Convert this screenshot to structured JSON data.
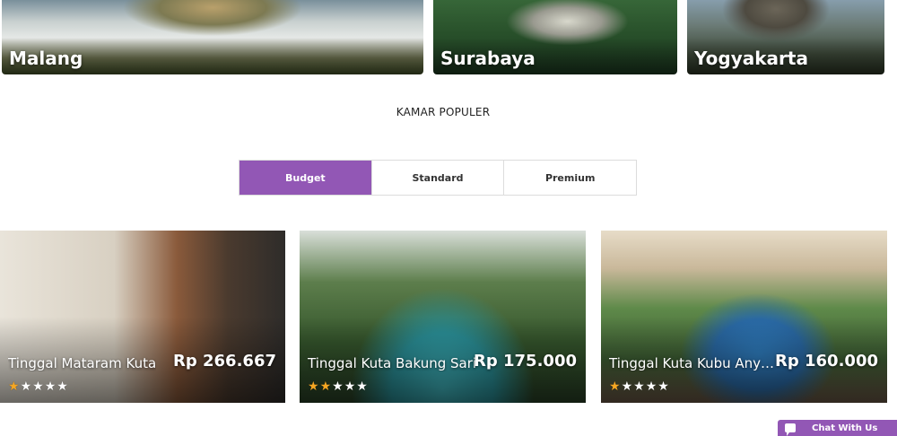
{
  "cities": [
    {
      "name": "Malang"
    },
    {
      "name": "Surabaya"
    },
    {
      "name": "Yogyakarta"
    }
  ],
  "section": {
    "title": "KAMAR POPULER"
  },
  "tabs": [
    {
      "label": "Budget",
      "active": true
    },
    {
      "label": "Standard",
      "active": false
    },
    {
      "label": "Premium",
      "active": false
    }
  ],
  "rooms": [
    {
      "name": "Tinggal Mataram Kuta",
      "price": "Rp 266.667",
      "rating": 1
    },
    {
      "name": "Tinggal Kuta Bakung Sari",
      "price": "Rp 175.000",
      "rating": 2
    },
    {
      "name": "Tinggal Kuta Kubu Anyar ...",
      "price": "Rp 160.000",
      "rating": 1
    }
  ],
  "chat": {
    "label": "Chat With Us"
  },
  "colors": {
    "accent": "#9257b5",
    "star": "#f5a623"
  },
  "icons": {
    "chat": "chat-bubble-icon",
    "star": "star-icon"
  }
}
